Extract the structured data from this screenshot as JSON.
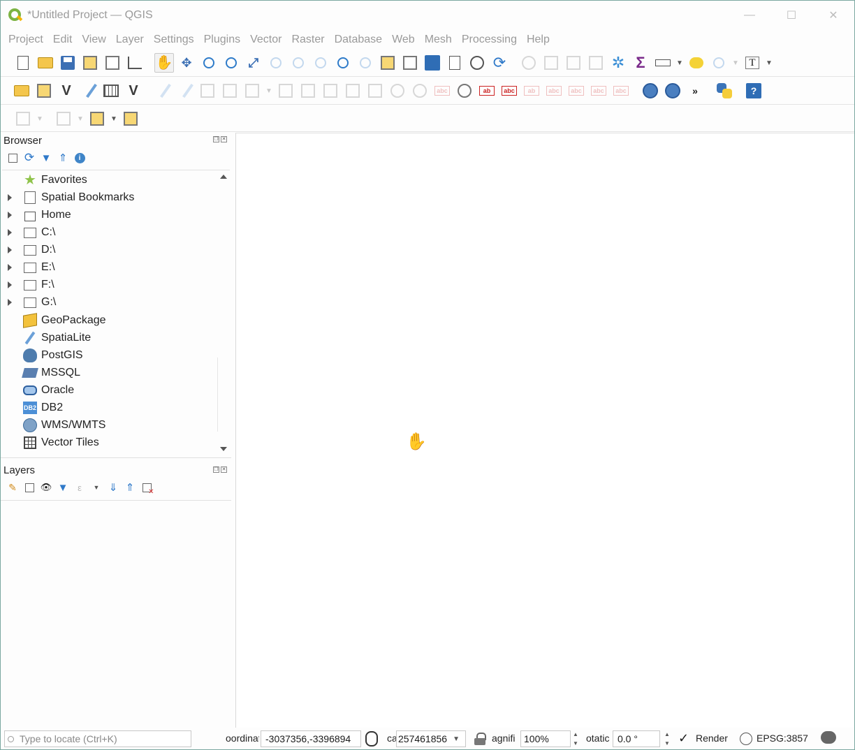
{
  "window": {
    "title": "*Untitled Project — QGIS",
    "controls": {
      "minimize": "—",
      "maximize": "☐",
      "close": "✕"
    }
  },
  "menu": [
    "Project",
    "Edit",
    "View",
    "Layer",
    "Settings",
    "Plugins",
    "Vector",
    "Raster",
    "Database",
    "Web",
    "Mesh",
    "Processing",
    "Help"
  ],
  "toolbar_row1": [
    "new-project-icon",
    "open-project-icon",
    "save-project-icon",
    "new-print-layout-icon",
    "layout-manager-icon",
    "style-manager-icon",
    "pan-map-icon",
    "pan-to-selection-icon",
    "zoom-in-icon",
    "zoom-out-icon",
    "zoom-full-icon",
    "zoom-to-selection-icon",
    "zoom-to-layer-icon",
    "zoom-native-icon",
    "zoom-last-icon",
    "zoom-next-icon",
    "new-map-view-icon",
    "new-3d-map-icon",
    "new-bookmark-icon",
    "show-bookmarks-icon",
    "temporal-controller-icon",
    "refresh-icon",
    "identify-icon",
    "select-features-icon",
    "select-by-value-icon",
    "deselect-icon",
    "attribute-table-icon",
    "toolbox-icon",
    "statistics-icon",
    "measure-icon",
    "map-tips-icon",
    "show-layout-icon",
    "text-annotation-icon"
  ],
  "toolbar_row2": [
    "data-source-manager-icon",
    "new-geopackage-layer-icon",
    "new-shapefile-layer-icon",
    "new-spatialite-layer-icon",
    "new-temporary-layer-icon",
    "new-virtual-layer-icon",
    "current-edits-icon",
    "toggle-editing-icon",
    "save-edits-icon",
    "digitize-icon",
    "add-feature-icon",
    "vertex-tool-icon",
    "modify-attributes-icon",
    "delete-selected-icon",
    "cut-features-icon",
    "copy-features-icon",
    "paste-features-icon",
    "undo-icon",
    "redo-icon",
    "label-toolbar-icon",
    "layer-labeling-icon",
    "layer-diagram-icon",
    "pin-label-icon",
    "highlight-pinned-icon",
    "show-hide-labels-icon",
    "move-label-icon",
    "rotate-label-icon",
    "change-label-icon",
    "metasearch-icon",
    "wms-search-icon",
    "more-tools-icon",
    "python-console-icon",
    "help-icon"
  ],
  "toolbar_row3": [
    "digitize-shape-icon",
    "snapping-icon",
    "select-polygon-icon",
    "annotation-icon"
  ],
  "browser": {
    "title": "Browser",
    "items": [
      {
        "label": "Favorites",
        "icon": "favorites-star-icon",
        "expandable": false
      },
      {
        "label": "Spatial Bookmarks",
        "icon": "bookmarks-icon",
        "expandable": true
      },
      {
        "label": "Home",
        "icon": "home-icon",
        "expandable": true
      },
      {
        "label": "C:\\",
        "icon": "folder-icon",
        "expandable": true
      },
      {
        "label": "D:\\",
        "icon": "folder-icon",
        "expandable": true
      },
      {
        "label": "E:\\",
        "icon": "folder-icon",
        "expandable": true
      },
      {
        "label": "F:\\",
        "icon": "folder-icon",
        "expandable": true
      },
      {
        "label": "G:\\",
        "icon": "folder-icon",
        "expandable": true
      },
      {
        "label": "GeoPackage",
        "icon": "geopackage-icon",
        "expandable": false
      },
      {
        "label": "SpatiaLite",
        "icon": "spatialite-icon",
        "expandable": false
      },
      {
        "label": "PostGIS",
        "icon": "postgis-icon",
        "expandable": false
      },
      {
        "label": "MSSQL",
        "icon": "mssql-icon",
        "expandable": false
      },
      {
        "label": "Oracle",
        "icon": "oracle-icon",
        "expandable": false
      },
      {
        "label": "DB2",
        "icon": "db2-icon",
        "expandable": false
      },
      {
        "label": "WMS/WMTS",
        "icon": "wms-icon",
        "expandable": false
      },
      {
        "label": "Vector Tiles",
        "icon": "vector-tiles-icon",
        "expandable": false
      }
    ],
    "db2_badge": "DB2"
  },
  "layers": {
    "title": "Layers"
  },
  "status": {
    "locator_placeholder": "Type to locate (Ctrl+K)",
    "coordinate_label": "oordinat",
    "coordinate_value": "-3037356,-3396894",
    "scale_label": "ca",
    "scale_value": "257461856",
    "magnifier_label": "agnifi",
    "magnifier_value": "100%",
    "rotation_label": "otatic",
    "rotation_value": "0.0 °",
    "render_label": "Render",
    "crs": "EPSG:3857"
  }
}
